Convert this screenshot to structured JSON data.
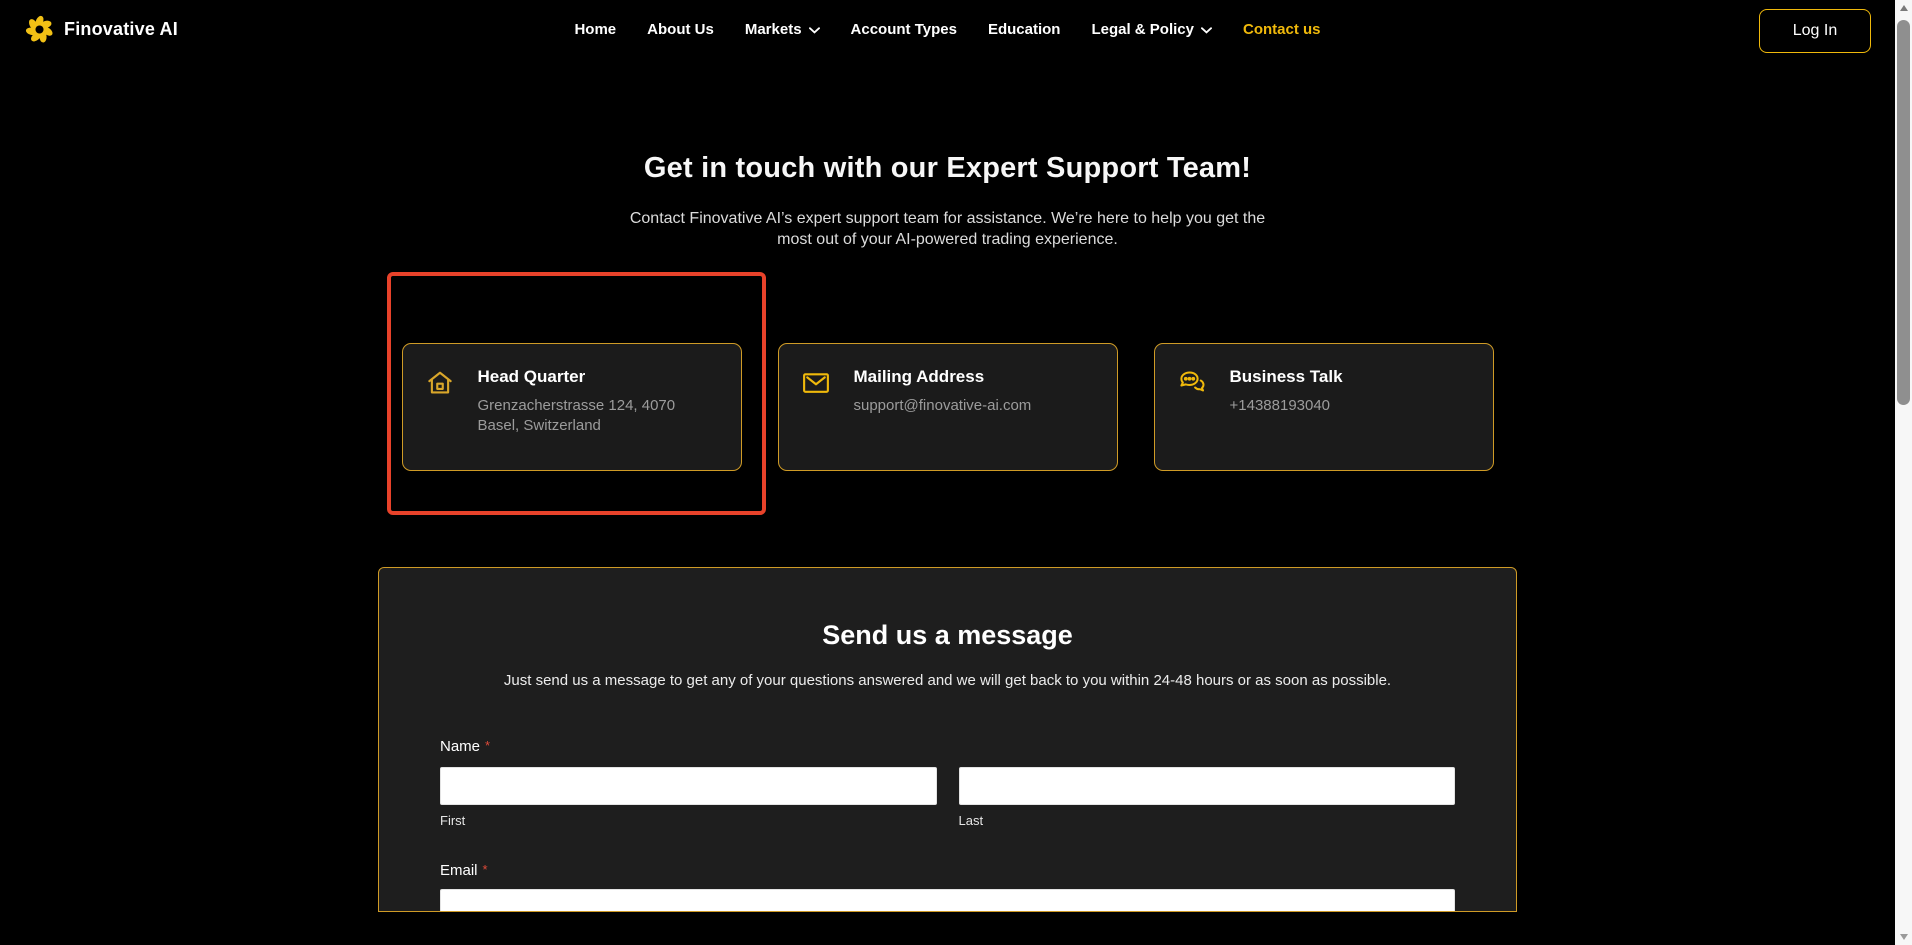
{
  "brand": {
    "name": "Finovative AI",
    "logo_icon": "aperture-flower-icon",
    "logo_color": "#f2c115"
  },
  "nav": {
    "items": [
      {
        "label": "Home",
        "dropdown": false,
        "active": false
      },
      {
        "label": "About Us",
        "dropdown": false,
        "active": false
      },
      {
        "label": "Markets",
        "dropdown": true,
        "active": false
      },
      {
        "label": "Account Types",
        "dropdown": false,
        "active": false
      },
      {
        "label": "Education",
        "dropdown": false,
        "active": false
      },
      {
        "label": "Legal & Policy",
        "dropdown": true,
        "active": false
      },
      {
        "label": "Contact us",
        "dropdown": false,
        "active": true
      }
    ],
    "login_label": "Log In"
  },
  "hero": {
    "title": "Get in touch with our Expert Support Team!",
    "subtitle": "Contact Finovative AI’s expert support team for assistance. We’re here to help you get the most out of your AI-powered trading experience."
  },
  "contact_cards": [
    {
      "icon": "home-icon",
      "title": "Head Quarter",
      "text": "Grenzacherstrasse 124, 4070 Basel, Switzerland",
      "highlighted": true
    },
    {
      "icon": "mail-icon",
      "title": "Mailing Address",
      "text": "support@finovative-ai.com",
      "highlighted": false
    },
    {
      "icon": "chat-icon",
      "title": "Business Talk",
      "text": "+14388193040",
      "highlighted": false
    }
  ],
  "form": {
    "title": "Send us a message",
    "subtitle": "Just send us a message to get any of your questions answered and we will get back to you within 24-48 hours or as soon as possible.",
    "name_label": "Name",
    "required_mark": "*",
    "first_hint": "First",
    "last_hint": "Last",
    "email_label": "Email",
    "first_value": "",
    "last_value": "",
    "email_value": ""
  },
  "colors": {
    "page_bg": "#000000",
    "accent_gold": "#f0b90b",
    "card_border_gold": "#cf9b26",
    "highlight_red": "#e8422a",
    "card_bg": "#1b1b1b",
    "muted_text": "#9c9c9c"
  },
  "scrollbar": {
    "thumb_position": "top",
    "orientation": "vertical"
  }
}
